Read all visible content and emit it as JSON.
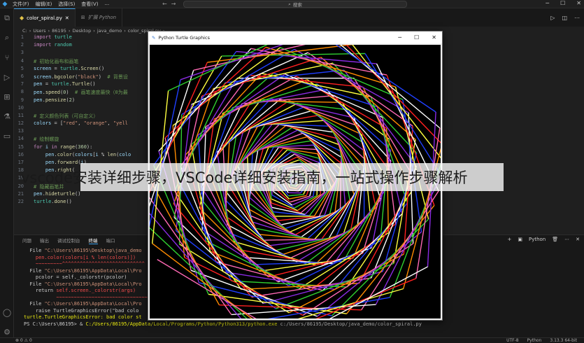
{
  "menu": [
    "文件(F)",
    "编辑(E)",
    "选择(S)",
    "查看(V)",
    "..."
  ],
  "search_label": "搜索",
  "tabs": [
    {
      "label": "color_spiral.py",
      "active": true
    },
    {
      "label": "扩展 Python",
      "active": false
    }
  ],
  "breadcrumb": [
    "C:",
    "Users",
    "86195",
    "Desktop",
    "java_demo",
    "color_spiral.py",
    "..."
  ],
  "code_lines": [
    {
      "n": "1",
      "html": "<span class=\"kw\">import</span> <span class=\"mod\">turtle</span>"
    },
    {
      "n": "2",
      "html": "<span class=\"kw\">import</span> <span class=\"mod\">random</span>"
    },
    {
      "n": "3",
      "html": ""
    },
    {
      "n": "4",
      "html": "<span class=\"cm\"># 初始化画布和画笔</span>"
    },
    {
      "n": "5",
      "html": "<span class=\"var\">screen</span> = <span class=\"mod\">turtle</span>.<span class=\"fn\">Screen</span>()"
    },
    {
      "n": "6",
      "html": "<span class=\"var\">screen</span>.<span class=\"fn\">bgcolor</span>(<span class=\"str\">\"black\"</span>)  <span class=\"cm\"># 背景设</span>"
    },
    {
      "n": "7",
      "html": "<span class=\"var\">pen</span> = <span class=\"mod\">turtle</span>.<span class=\"fn\">Turtle</span>()"
    },
    {
      "n": "8",
      "html": "<span class=\"var\">pen</span>.<span class=\"fn\">speed</span>(<span class=\"num\">0</span>)  <span class=\"cm\"># 画笔速度最快（0为最</span>"
    },
    {
      "n": "9",
      "html": "<span class=\"var\">pen</span>.<span class=\"fn\">pensize</span>(<span class=\"num\">2</span>)"
    },
    {
      "n": "10",
      "html": ""
    },
    {
      "n": "11",
      "html": "<span class=\"cm\"># 定义颜色列表（可自定义）</span>"
    },
    {
      "n": "12",
      "html": "<span class=\"var\">colors</span> = [<span class=\"str\">\"red\"</span>, <span class=\"str\">\"orange\"</span>, <span class=\"str\">\"yell</span>"
    },
    {
      "n": "13",
      "html": ""
    },
    {
      "n": "14",
      "html": "<span class=\"cm\"># 绘制螺旋</span>"
    },
    {
      "n": "15",
      "html": "<span class=\"kw\">for</span> <span class=\"var\">i</span> <span class=\"kw\">in</span> <span class=\"fn\">range</span>(<span class=\"num\">360</span>):"
    },
    {
      "n": "16",
      "html": "    <span class=\"var\">pen</span>.<span class=\"fn\">color</span>(<span class=\"var\">colors</span>[<span class=\"var\">i</span> % <span class=\"fn\">len</span>(<span class=\"var\">colo</span>"
    },
    {
      "n": "17",
      "html": "    <span class=\"var\">pen</span>.<span class=\"fn\">forward</span>(<span class=\"var\">i</span>)"
    },
    {
      "n": "18",
      "html": "    <span class=\"var\">pen</span>.<span class=\"fn\">right</span>("
    },
    {
      "n": "19",
      "html": ""
    },
    {
      "n": "20",
      "html": "<span class=\"cm\"># 隐藏画笔并</span>"
    },
    {
      "n": "21",
      "html": "<span class=\"var\">pen</span>.<span class=\"fn\">hideturtle</span>()"
    },
    {
      "n": "22",
      "html": "<span class=\"mod\">turtle</span>.<span class=\"fn\">done</span>()"
    }
  ],
  "panel_tabs": [
    "问题",
    "输出",
    "调试控制台",
    "终端",
    "端口"
  ],
  "panel_active": "终端",
  "panel_python": "Python",
  "terminal_lines": [
    {
      "html": "  File <span class=\"t-str\">\"C:\\Users\\86195\\Desktop\\java_demo</span>"
    },
    {
      "html": "    <span class=\"t-red\">pen.color(colors[i % len(colors)])</span>"
    },
    {
      "html": "    <span class=\"t-red\">~~~~~~~~~^^^^^^^^^^^^^^^^^^^^^^^^^^^^</span>"
    },
    {
      "html": "  File <span class=\"t-str\">\"C:\\Users\\86195\\AppData\\Local\\Pro</span>"
    },
    {
      "html": "    pcolor = self._colorstr(pcolor)"
    },
    {
      "html": "  File <span class=\"t-str\">\"C:\\Users\\86195\\AppData\\Local\\Pro</span>"
    },
    {
      "html": "    return <span class=\"t-red\">self.screen._colorstr(args)</span>"
    },
    {
      "html": "           <span class=\"t-red\">~~~~~~~~~~~~~~~~~~~~~~~~~~~~~~~</span>"
    },
    {
      "html": "  File <span class=\"t-str\">\"C:\\Users\\86195\\AppData\\Local\\Pro</span>"
    },
    {
      "html": "    raise TurtleGraphicsError(\"bad colo</span>"
    },
    {
      "html": "<span class=\"t-yel\">turtle.TurtleGraphicsError: bad color st</span>"
    },
    {
      "html": "PS C:\\Users\\86195> &amp; <span class=\"t-yel\">C:/Users/86195/AppData/Local/Programs/Python/Python313/python.exe</span> c:/Users/86195/Desktop/java_demo/color_spiral.py"
    }
  ],
  "turtle_window": {
    "title": "Python Turtle Graphics"
  },
  "watermark": "vscode安装详细步骤，VSCode详细安装指南，一站式操作步骤解析",
  "status_right": [
    "3.13.3 64-bit",
    "Python",
    "UTF-8"
  ],
  "spiral_colors": [
    "#ff2020",
    "#ff8c00",
    "#ffff40",
    "#30d030",
    "#2040ff",
    "#8a2be2",
    "#ffffff",
    "#ff69b4"
  ]
}
